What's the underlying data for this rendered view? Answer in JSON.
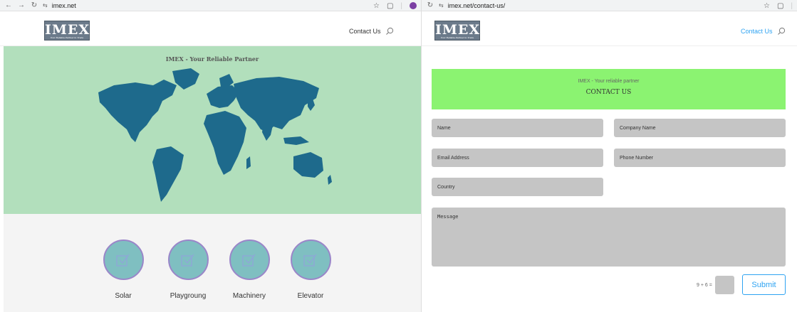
{
  "left_window": {
    "url": "imex.net",
    "logo_text": "IMEX",
    "logo_tagline": "Your Reliable Partner in Trade",
    "nav_contact": "Contact Us",
    "hero_title": "IMEX - Your Reliable Partner",
    "categories": [
      {
        "label": "Solar",
        "icon": "checkbox-icon"
      },
      {
        "label": "Playgroung",
        "icon": "checkbox-icon"
      },
      {
        "label": "Machinery",
        "icon": "checkbox-icon"
      },
      {
        "label": "Elevator",
        "icon": "checkbox-icon"
      }
    ],
    "colors": {
      "hero_bg": "#b2dfbc",
      "map": "#1e6a8c",
      "circle": "#7fbfc1"
    }
  },
  "right_window": {
    "url": "imex.net/contact-us/",
    "logo_text": "IMEX",
    "logo_tagline": "Your Reliable Partner in Trade",
    "nav_contact": "Contact Us",
    "banner_subtitle": "IMEX - Your reliable partner",
    "banner_title": "CONTACT US",
    "fields": {
      "name": "Name",
      "company": "Company Name",
      "email": "Email Address",
      "phone": "Phone Number",
      "country": "Country",
      "message": "Message"
    },
    "captcha_label": "9 + 6 =",
    "captcha_value": "",
    "submit_label": "Submit",
    "colors": {
      "banner": "#8bf371",
      "accent": "#2ea3f2",
      "field": "#c5c5c5"
    }
  }
}
